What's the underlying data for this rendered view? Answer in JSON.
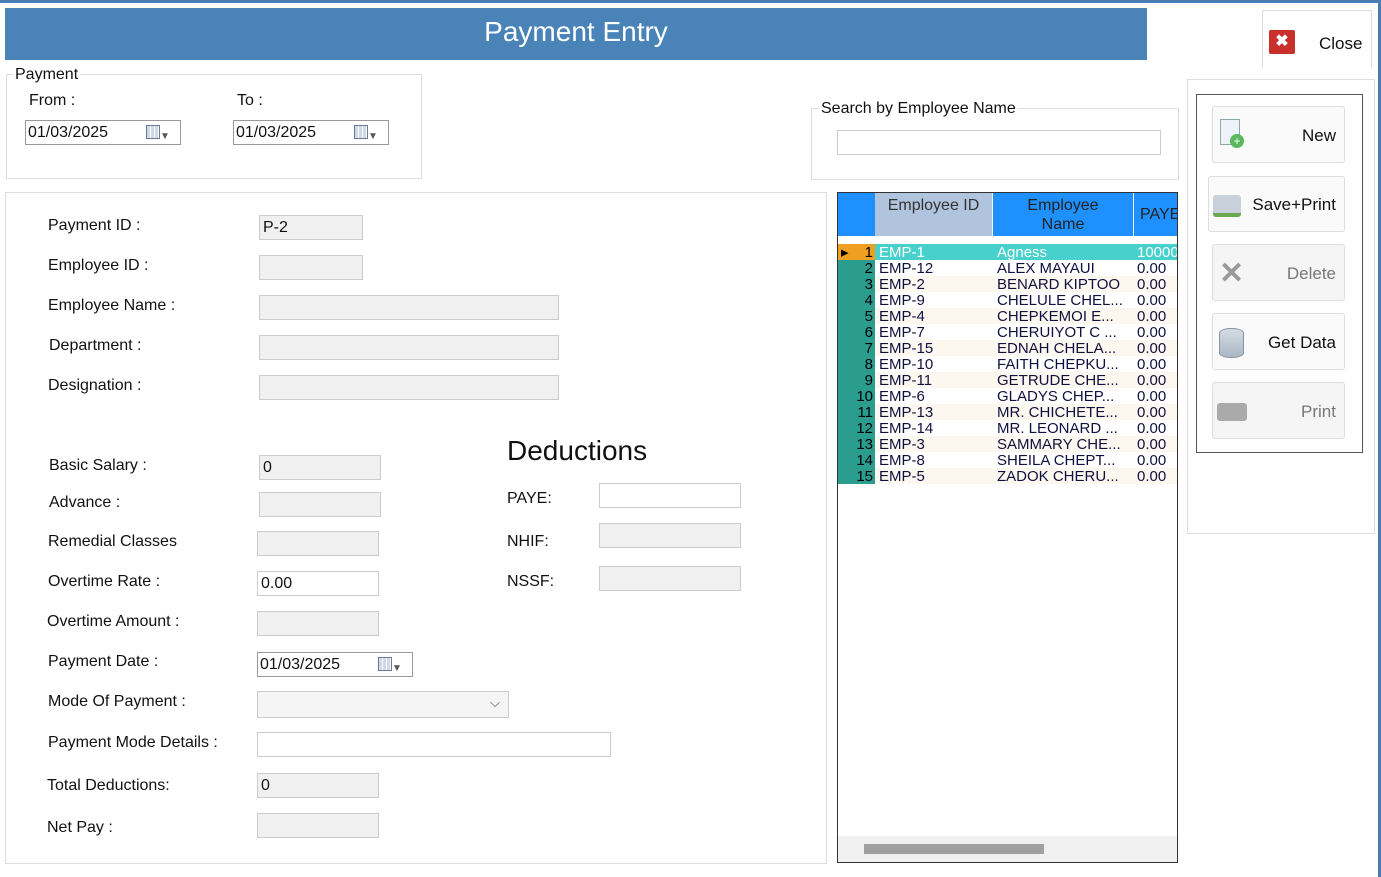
{
  "title": "Payment Entry",
  "close_label": "Close",
  "payment_group": {
    "label": "Payment",
    "from_label": "From :",
    "to_label": "To :",
    "from": "01/03/2025",
    "to": "01/03/2025"
  },
  "search": {
    "label": "Search by Employee Name",
    "value": ""
  },
  "form": {
    "payment_id_label": "Payment ID :",
    "payment_id": "P-2",
    "employee_id_label": "Employee ID :",
    "employee_id": "",
    "employee_name_label": "Employee Name :",
    "employee_name": "",
    "department_label": "Department :",
    "department": "",
    "designation_label": "Designation :",
    "designation": "",
    "basic_salary_label": "Basic Salary :",
    "basic_salary": "0",
    "advance_label": "Advance :",
    "advance": "",
    "remedial_label": "Remedial Classes",
    "remedial": "",
    "overtime_rate_label": "Overtime Rate :",
    "overtime_rate": "0.00",
    "overtime_amount_label": "Overtime Amount :",
    "overtime_amount": "",
    "payment_date_label": "Payment Date :",
    "payment_date": "01/03/2025",
    "mode_label": "Mode Of Payment :",
    "mode": "",
    "mode_details_label": "Payment Mode Details :",
    "mode_details": "",
    "total_deductions_label": "Total Deductions:",
    "total_deductions": "0",
    "net_pay_label": "Net Pay :",
    "net_pay": ""
  },
  "deductions": {
    "heading": "Deductions",
    "paye_label": "PAYE:",
    "paye": "",
    "nhif_label": "NHIF:",
    "nhif": "",
    "nssf_label": "NSSF:",
    "nssf": ""
  },
  "buttons": {
    "new": "New",
    "save_print": "Save+Print",
    "delete": "Delete",
    "get_data": "Get Data",
    "print": "Print"
  },
  "grid": {
    "headers": [
      "Employee ID",
      "Employee Name",
      "PAYE"
    ],
    "rows": [
      [
        "1",
        "EMP-1",
        "Agness",
        "10000"
      ],
      [
        "2",
        "EMP-12",
        "ALEX MAYAUI",
        "0.00"
      ],
      [
        "3",
        "EMP-2",
        "BENARD KIPTOO",
        "0.00"
      ],
      [
        "4",
        "EMP-9",
        "CHELULE CHEL...",
        "0.00"
      ],
      [
        "5",
        "EMP-4",
        "CHEPKEMOI E...",
        "0.00"
      ],
      [
        "6",
        "EMP-7",
        "CHERUIYOT C ...",
        "0.00"
      ],
      [
        "7",
        "EMP-15",
        "EDNAH CHELA...",
        "0.00"
      ],
      [
        "8",
        "EMP-10",
        "FAITH CHEPKU...",
        "0.00"
      ],
      [
        "9",
        "EMP-11",
        "GETRUDE CHE...",
        "0.00"
      ],
      [
        "10",
        "EMP-6",
        "GLADYS CHEP...",
        "0.00"
      ],
      [
        "11",
        "EMP-13",
        "MR. CHICHETE...",
        "0.00"
      ],
      [
        "12",
        "EMP-14",
        "MR. LEONARD ...",
        "0.00"
      ],
      [
        "13",
        "EMP-3",
        "SAMMARY CHE...",
        "0.00"
      ],
      [
        "14",
        "EMP-8",
        "SHEILA CHEPT...",
        "0.00"
      ],
      [
        "15",
        "EMP-5",
        "ZADOK CHERU...",
        "0.00"
      ]
    ]
  }
}
